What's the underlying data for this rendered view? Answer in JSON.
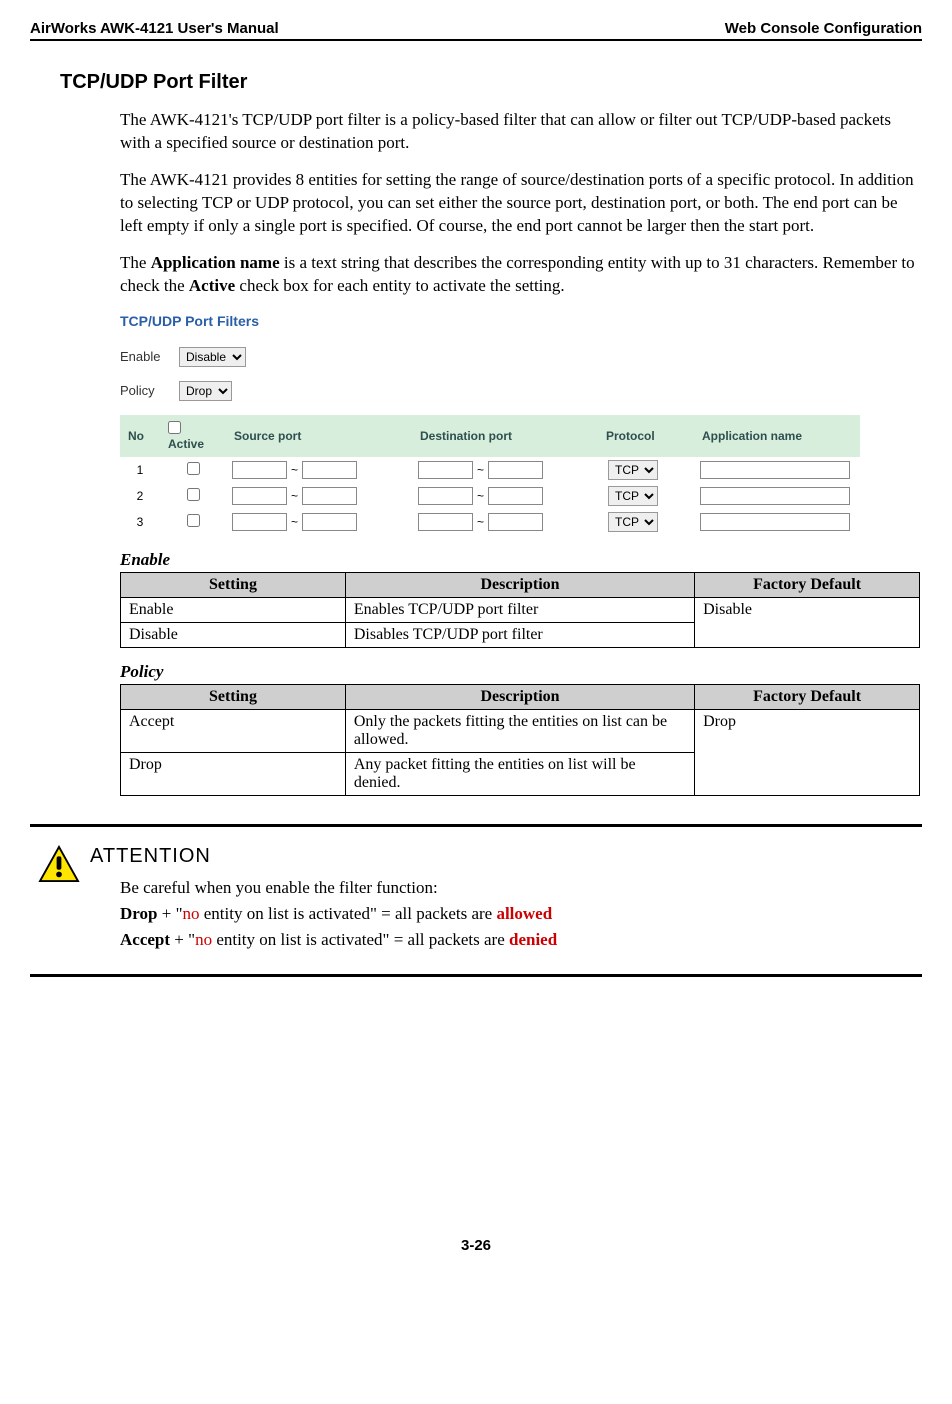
{
  "header": {
    "left": "AirWorks AWK-4121 User's Manual",
    "right": "Web Console Configuration"
  },
  "section_title": "TCP/UDP Port Filter",
  "paragraphs": {
    "p1": "The AWK-4121's TCP/UDP port filter is a policy-based filter that can allow or filter out TCP/UDP-based packets with a specified source or destination port.",
    "p2": "The AWK-4121 provides 8 entities for setting the range of source/destination ports of a specific protocol. In addition to selecting TCP or UDP protocol, you can set either the source port, destination port, or both. The end port can be left empty if only a single port is specified. Of course, the end port cannot be larger then the start port.",
    "p3_pre": "The ",
    "p3_b1": "Application name",
    "p3_mid": " is a text string that describes the corresponding entity with up to 31 characters. Remember to check the ",
    "p3_b2": "Active",
    "p3_post": " check box for each entity to activate the setting."
  },
  "screenshot": {
    "title": "TCP/UDP Port Filters",
    "enable_label": "Enable",
    "enable_value": "Disable",
    "policy_label": "Policy",
    "policy_value": "Drop",
    "cols": {
      "no": "No",
      "active": "Active",
      "source": "Source port",
      "dest": "Destination port",
      "protocol": "Protocol",
      "app": "Application name"
    },
    "rows": [
      {
        "no": "1",
        "protocol": "TCP"
      },
      {
        "no": "2",
        "protocol": "TCP"
      },
      {
        "no": "3",
        "protocol": "TCP"
      }
    ]
  },
  "enable_table": {
    "heading": "Enable",
    "cols": {
      "setting": "Setting",
      "desc": "Description",
      "fac": "Factory Default"
    },
    "rows": [
      {
        "setting": "Enable",
        "desc": "Enables TCP/UDP port filter"
      },
      {
        "setting": "Disable",
        "desc": "Disables TCP/UDP port filter"
      }
    ],
    "fac": "Disable"
  },
  "policy_table": {
    "heading": "Policy",
    "cols": {
      "setting": "Setting",
      "desc": "Description",
      "fac": "Factory Default"
    },
    "rows": [
      {
        "setting": "Accept",
        "desc": "Only the packets fitting the entities on list can be allowed."
      },
      {
        "setting": "Drop",
        "desc": "Any packet fitting the entities on list will be denied."
      }
    ],
    "fac": "Drop"
  },
  "attention": {
    "title": "ATTENTION",
    "line1": "Be careful when you enable the filter function:",
    "l2_b": "Drop",
    "l2_plus": " + \"",
    "l2_no": "no",
    "l2_mid": " entity on list is activated\" = all packets are ",
    "l2_end": "allowed",
    "l3_b": "Accept",
    "l3_plus": " + \"",
    "l3_no": "no",
    "l3_mid": " entity on list is activated\" = all packets are ",
    "l3_end": "denied"
  },
  "footer": "3-26"
}
